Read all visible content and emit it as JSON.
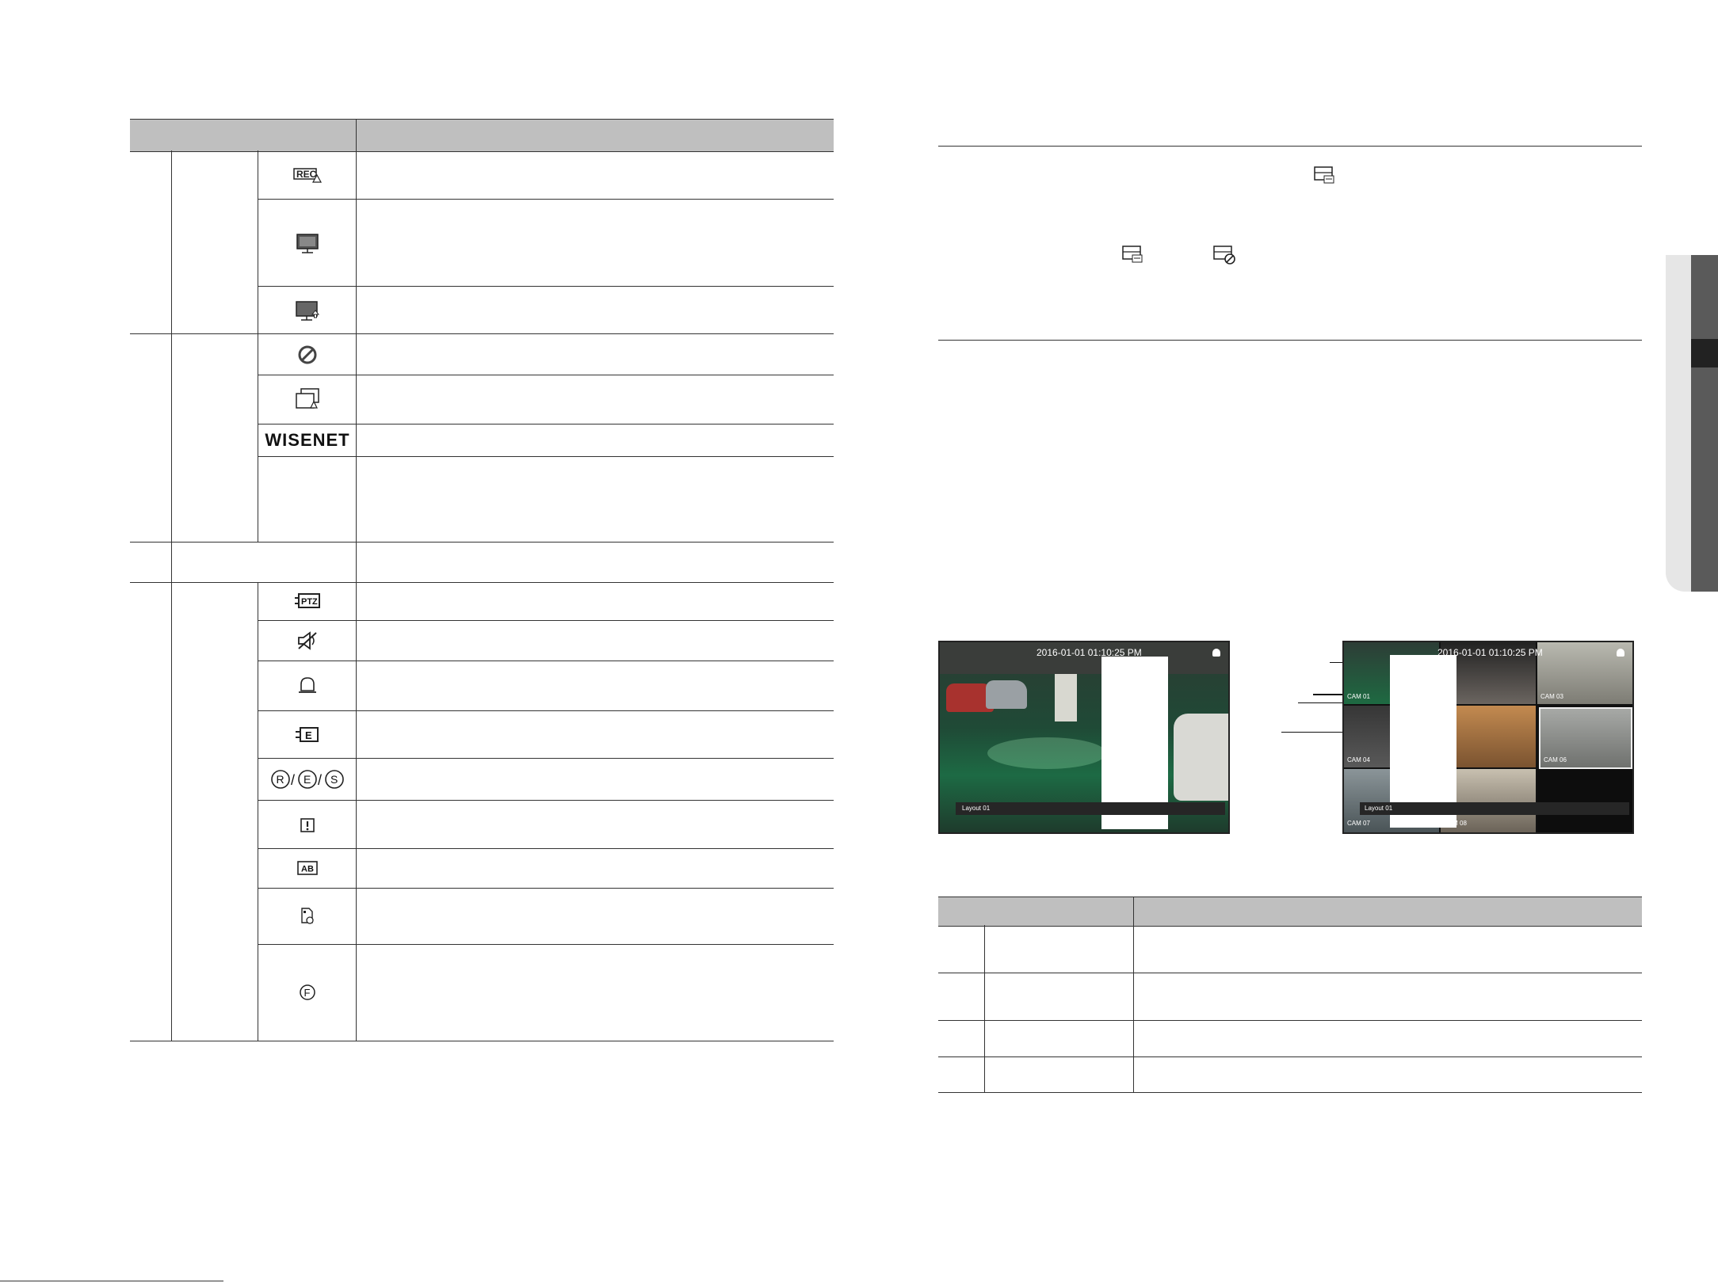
{
  "monitor_left": {
    "date": "2016-01-01 01:10:25 PM",
    "layout_label": "Layout 01"
  },
  "monitor_right": {
    "date": "2016-01-01 01:10:25 PM",
    "layout_label": "Layout 01",
    "cams": [
      "CAM 01",
      "CAM 03",
      "CAM 04",
      "CAM 06",
      "CAM 07",
      "CAM 08"
    ]
  },
  "icons": {
    "rec": "REC",
    "wisenet": "WISENET",
    "ptz": "PTZ",
    "ab": "AB",
    "r": "R",
    "e": "E",
    "s": "S",
    "f": "F",
    "slash": "/"
  },
  "colors": {
    "header_gray": "#bfbfbf",
    "side_tab": "#e6e6e6",
    "side_dark": "#222222"
  }
}
